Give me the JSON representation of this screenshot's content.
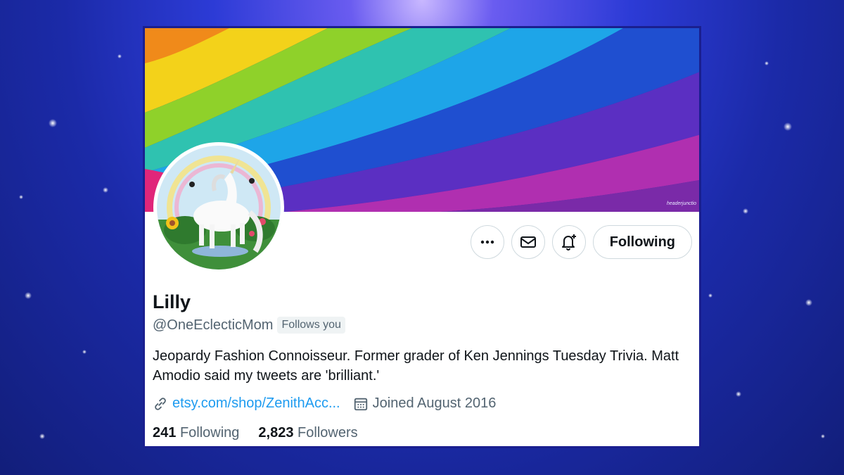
{
  "profile": {
    "name": "Lilly",
    "handle": "@OneEclecticMom",
    "follows_you": "Follows you",
    "bio": "Jeopardy Fashion Connoisseur. Former grader of Ken Jennings Tuesday Trivia. Matt Amodio said my tweets are 'brilliant.'",
    "link": "etsy.com/shop/ZenithAcc...",
    "joined": "Joined August 2016",
    "following_count": "241",
    "following_label": "Following",
    "followers_count": "2,823",
    "followers_label": "Followers"
  },
  "banner": {
    "credit": "headerjunctio"
  },
  "actions": {
    "more_icon": "more-horizontal-icon",
    "message_icon": "envelope-icon",
    "notify_icon": "bell-plus-icon",
    "following_label": "Following"
  },
  "colors": {
    "link_blue": "#1d9bf0",
    "text_primary": "#0f1419",
    "text_secondary": "#536471",
    "border": "#cfd9de"
  }
}
